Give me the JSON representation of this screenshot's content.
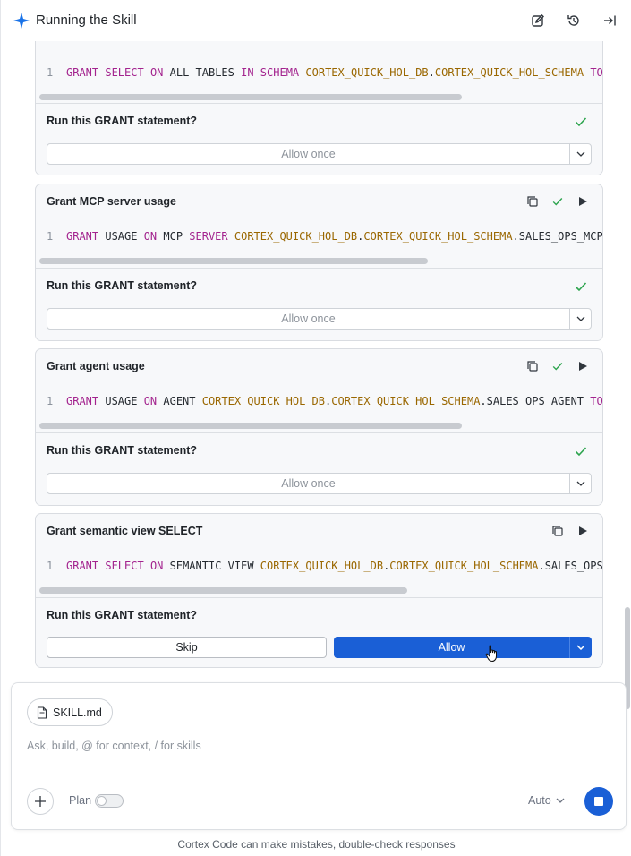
{
  "header": {
    "title": "Running the Skill",
    "icons": [
      "edit-icon",
      "history-icon",
      "collapse-panel-icon"
    ]
  },
  "colors": {
    "accent": "#1a5fd6",
    "keyword": "#a3238e",
    "identifier": "#9a6700",
    "check": "#2da44e"
  },
  "cards": [
    {
      "title": "",
      "line_no": "1",
      "code": [
        {
          "t": "GRANT",
          "c": "kw"
        },
        {
          "t": " ",
          "c": "pl"
        },
        {
          "t": "SELECT",
          "c": "kw"
        },
        {
          "t": " ",
          "c": "pl"
        },
        {
          "t": "ON",
          "c": "kw"
        },
        {
          "t": " ALL TABLES ",
          "c": "pl"
        },
        {
          "t": "IN",
          "c": "kw"
        },
        {
          "t": " ",
          "c": "pl"
        },
        {
          "t": "SCHEMA",
          "c": "kw"
        },
        {
          "t": " ",
          "c": "pl"
        },
        {
          "t": "CORTEX_QUICK_HOL_DB",
          "c": "id"
        },
        {
          "t": ".",
          "c": "pl"
        },
        {
          "t": "CORTEX_QUICK_HOL_SCHEMA",
          "c": "id"
        },
        {
          "t": " ",
          "c": "pl"
        },
        {
          "t": "TO",
          "c": "kw"
        }
      ],
      "question": "Run this GRANT statement?",
      "decision": "Allow once",
      "answered": true
    },
    {
      "title": "Grant MCP server usage",
      "line_no": "1",
      "code": [
        {
          "t": "GRANT",
          "c": "kw"
        },
        {
          "t": " USAGE ",
          "c": "pl"
        },
        {
          "t": "ON",
          "c": "kw"
        },
        {
          "t": " MCP ",
          "c": "pl"
        },
        {
          "t": "SERVER",
          "c": "kw"
        },
        {
          "t": " ",
          "c": "pl"
        },
        {
          "t": "CORTEX_QUICK_HOL_DB",
          "c": "id"
        },
        {
          "t": ".",
          "c": "pl"
        },
        {
          "t": "CORTEX_QUICK_HOL_SCHEMA",
          "c": "id"
        },
        {
          "t": ".SALES_OPS_MCP",
          "c": "pl"
        }
      ],
      "question": "Run this GRANT statement?",
      "decision": "Allow once",
      "answered": true
    },
    {
      "title": "Grant agent usage",
      "line_no": "1",
      "code": [
        {
          "t": "GRANT",
          "c": "kw"
        },
        {
          "t": " USAGE ",
          "c": "pl"
        },
        {
          "t": "ON",
          "c": "kw"
        },
        {
          "t": " AGENT ",
          "c": "pl"
        },
        {
          "t": "CORTEX_QUICK_HOL_DB",
          "c": "id"
        },
        {
          "t": ".",
          "c": "pl"
        },
        {
          "t": "CORTEX_QUICK_HOL_SCHEMA",
          "c": "id"
        },
        {
          "t": ".SALES_OPS_AGENT ",
          "c": "pl"
        },
        {
          "t": "TO",
          "c": "kw"
        }
      ],
      "question": "Run this GRANT statement?",
      "decision": "Allow once",
      "answered": true
    },
    {
      "title": "Grant semantic view SELECT",
      "line_no": "1",
      "code": [
        {
          "t": "GRANT",
          "c": "kw"
        },
        {
          "t": " ",
          "c": "pl"
        },
        {
          "t": "SELECT",
          "c": "kw"
        },
        {
          "t": " ",
          "c": "pl"
        },
        {
          "t": "ON",
          "c": "kw"
        },
        {
          "t": " SEMANTIC VIEW ",
          "c": "pl"
        },
        {
          "t": "CORTEX_QUICK_HOL_DB",
          "c": "id"
        },
        {
          "t": ".",
          "c": "pl"
        },
        {
          "t": "CORTEX_QUICK_HOL_SCHEMA",
          "c": "id"
        },
        {
          "t": ".SALES_OPS",
          "c": "pl"
        }
      ],
      "question": "Run this GRANT statement?",
      "skip_label": "Skip",
      "allow_label": "Allow",
      "answered": false
    }
  ],
  "composer": {
    "attachment": "SKILL.md",
    "placeholder": "Ask, build, @ for context, / for skills",
    "plan_label": "Plan",
    "plan_enabled": false,
    "mode_label": "Auto"
  },
  "footer": "Cortex Code can make mistakes, double-check responses"
}
